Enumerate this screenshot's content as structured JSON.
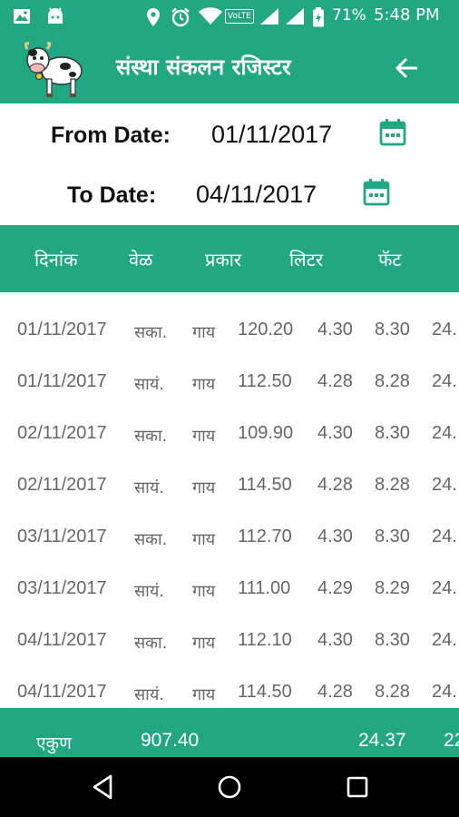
{
  "status": {
    "battery_pct": "71%",
    "time": "5:48 PM",
    "volte": "VoLTE"
  },
  "app": {
    "title": "संस्था संकलन रजिस्टर"
  },
  "filters": {
    "from_label": "From Date:",
    "from_value": "01/11/2017",
    "to_label": "To Date:",
    "to_value": "04/11/2017"
  },
  "table": {
    "columns": [
      "दिनांक",
      "वेळ",
      "प्रकार",
      "लिटर",
      "फॅट"
    ],
    "rows": [
      {
        "date": "01/11/2017",
        "time": "सका.",
        "type": "गाय",
        "liter": "120.20",
        "fat": "4.30",
        "snf": "8.30",
        "rate": "24."
      },
      {
        "date": "01/11/2017",
        "time": "सायं.",
        "type": "गाय",
        "liter": "112.50",
        "fat": "4.28",
        "snf": "8.28",
        "rate": "24."
      },
      {
        "date": "02/11/2017",
        "time": "सका.",
        "type": "गाय",
        "liter": "109.90",
        "fat": "4.30",
        "snf": "8.30",
        "rate": "24."
      },
      {
        "date": "02/11/2017",
        "time": "सायं.",
        "type": "गाय",
        "liter": "114.50",
        "fat": "4.28",
        "snf": "8.28",
        "rate": "24."
      },
      {
        "date": "03/11/2017",
        "time": "सका.",
        "type": "गाय",
        "liter": "112.70",
        "fat": "4.30",
        "snf": "8.30",
        "rate": "24."
      },
      {
        "date": "03/11/2017",
        "time": "सायं.",
        "type": "गाय",
        "liter": "111.00",
        "fat": "4.29",
        "snf": "8.29",
        "rate": "24."
      },
      {
        "date": "04/11/2017",
        "time": "सका.",
        "type": "गाय",
        "liter": "112.10",
        "fat": "4.30",
        "snf": "8.30",
        "rate": "24."
      },
      {
        "date": "04/11/2017",
        "time": "सायं.",
        "type": "गाय",
        "liter": "114.50",
        "fat": "4.28",
        "snf": "8.28",
        "rate": "24."
      }
    ]
  },
  "totals": {
    "label": "एकुण",
    "liters": "907.40",
    "avg": "24.37",
    "amount": "22"
  },
  "colors": {
    "primary": "#21a883",
    "icon_green": "#21a883",
    "nav": "#000000"
  },
  "icons": [
    "image-icon",
    "android-icon",
    "location-icon",
    "alarm-icon",
    "wifi-icon",
    "signal-icon",
    "battery-icon",
    "back-arrow-icon",
    "calendar-icon",
    "nav-back-icon",
    "nav-home-icon",
    "nav-recents-icon"
  ]
}
